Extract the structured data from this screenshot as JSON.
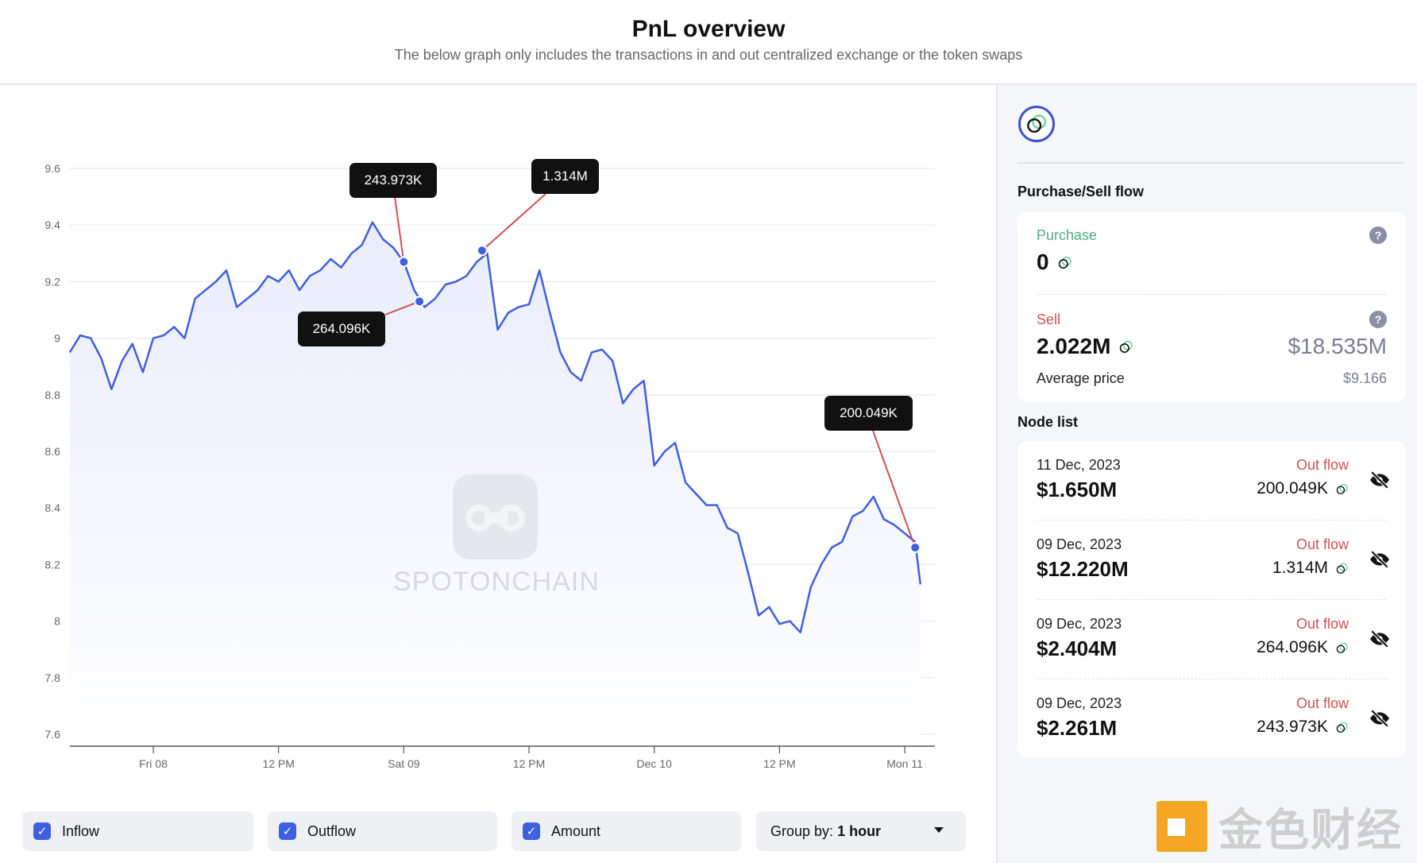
{
  "header": {
    "title": "PnL overview",
    "subtitle": "The below graph only includes the transactions in and out centralized exchange or the token swaps"
  },
  "watermark": {
    "text": "SPOTONCHAIN"
  },
  "chart_data": {
    "type": "area",
    "line_color": "#3d5fe0",
    "fill_color": "#e9ecfc",
    "grid": true,
    "ylim": [
      7.6,
      9.6
    ],
    "y_ticks": [
      "9.6",
      "9.4",
      "9.2",
      "9",
      "8.8",
      "8.6",
      "8.4",
      "8.2",
      "8",
      "7.8",
      "7.6"
    ],
    "x_ticks": [
      {
        "label": "Fri 08",
        "t": "2023-12-08T00:00"
      },
      {
        "label": "12 PM",
        "t": "2023-12-08T12:00"
      },
      {
        "label": "Sat 09",
        "t": "2023-12-09T00:00"
      },
      {
        "label": "12 PM",
        "t": "2023-12-09T12:00"
      },
      {
        "label": "Dec 10",
        "t": "2023-12-10T00:00"
      },
      {
        "label": "12 PM",
        "t": "2023-12-10T12:00"
      },
      {
        "label": "Mon 11",
        "t": "2023-12-11T00:00"
      }
    ],
    "x_range": [
      "2023-12-07T16:00",
      "2023-12-11T02:30"
    ],
    "x": [
      "2023-12-07T16:00",
      "2023-12-07T17:00",
      "2023-12-07T18:00",
      "2023-12-07T19:00",
      "2023-12-07T20:00",
      "2023-12-07T21:00",
      "2023-12-07T22:00",
      "2023-12-07T23:00",
      "2023-12-08T00:00",
      "2023-12-08T01:00",
      "2023-12-08T02:00",
      "2023-12-08T03:00",
      "2023-12-08T04:00",
      "2023-12-08T05:00",
      "2023-12-08T06:00",
      "2023-12-08T07:00",
      "2023-12-08T08:00",
      "2023-12-08T09:00",
      "2023-12-08T10:00",
      "2023-12-08T11:00",
      "2023-12-08T12:00",
      "2023-12-08T13:00",
      "2023-12-08T14:00",
      "2023-12-08T15:00",
      "2023-12-08T16:00",
      "2023-12-08T17:00",
      "2023-12-08T18:00",
      "2023-12-08T19:00",
      "2023-12-08T20:00",
      "2023-12-08T21:00",
      "2023-12-08T22:00",
      "2023-12-08T23:00",
      "2023-12-09T00:00",
      "2023-12-09T01:00",
      "2023-12-09T02:00",
      "2023-12-09T03:00",
      "2023-12-09T04:00",
      "2023-12-09T05:00",
      "2023-12-09T06:00",
      "2023-12-09T07:00",
      "2023-12-09T08:00",
      "2023-12-09T09:00",
      "2023-12-09T10:00",
      "2023-12-09T11:00",
      "2023-12-09T12:00",
      "2023-12-09T13:00",
      "2023-12-09T14:00",
      "2023-12-09T15:00",
      "2023-12-09T16:00",
      "2023-12-09T17:00",
      "2023-12-09T18:00",
      "2023-12-09T19:00",
      "2023-12-09T20:00",
      "2023-12-09T21:00",
      "2023-12-09T22:00",
      "2023-12-09T23:00",
      "2023-12-10T00:00",
      "2023-12-10T01:00",
      "2023-12-10T02:00",
      "2023-12-10T03:00",
      "2023-12-10T04:00",
      "2023-12-10T05:00",
      "2023-12-10T06:00",
      "2023-12-10T07:00",
      "2023-12-10T08:00",
      "2023-12-10T09:00",
      "2023-12-10T10:00",
      "2023-12-10T11:00",
      "2023-12-10T12:00",
      "2023-12-10T13:00",
      "2023-12-10T14:00",
      "2023-12-10T15:00",
      "2023-12-10T16:00",
      "2023-12-10T17:00",
      "2023-12-10T18:00",
      "2023-12-10T19:00",
      "2023-12-10T20:00",
      "2023-12-10T21:00",
      "2023-12-10T22:00",
      "2023-12-10T23:00",
      "2023-12-11T00:00",
      "2023-12-11T01:00",
      "2023-12-11T01:30"
    ],
    "y": [
      8.95,
      9.01,
      9.0,
      8.93,
      8.82,
      8.92,
      8.98,
      8.88,
      9.0,
      9.01,
      9.04,
      9.0,
      9.14,
      9.17,
      9.2,
      9.24,
      9.11,
      9.14,
      9.17,
      9.22,
      9.2,
      9.24,
      9.17,
      9.22,
      9.24,
      9.28,
      9.25,
      9.3,
      9.33,
      9.41,
      9.35,
      9.32,
      9.27,
      9.17,
      9.11,
      9.14,
      9.19,
      9.2,
      9.22,
      9.27,
      9.3,
      9.03,
      9.09,
      9.11,
      9.12,
      9.24,
      9.09,
      8.95,
      8.88,
      8.85,
      8.95,
      8.96,
      8.92,
      8.77,
      8.82,
      8.85,
      8.55,
      8.6,
      8.63,
      8.49,
      8.45,
      8.41,
      8.41,
      8.33,
      8.31,
      8.17,
      8.02,
      8.05,
      7.99,
      8.0,
      7.96,
      8.12,
      8.2,
      8.26,
      8.28,
      8.37,
      8.39,
      8.44,
      8.36,
      8.34,
      8.31,
      8.28,
      8.13
    ],
    "annotations": [
      {
        "label": "243.973K",
        "t": "2023-12-09T00:00",
        "y": 9.27,
        "line_color": "#d2504f"
      },
      {
        "label": "1.314M",
        "t": "2023-12-09T07:30",
        "y": 9.31,
        "line_color": "#d2504f"
      },
      {
        "label": "264.096K",
        "t": "2023-12-09T01:30",
        "y": 9.13,
        "line_color": "#d2504f"
      },
      {
        "label": "200.049K",
        "t": "2023-12-11T01:00",
        "y": 8.26,
        "line_color": "#d2504f"
      }
    ]
  },
  "controls": {
    "inflow": {
      "label": "Inflow",
      "checked": true
    },
    "outflow": {
      "label": "Outflow",
      "checked": true
    },
    "amount": {
      "label": "Amount",
      "checked": true
    },
    "group_by": {
      "label": "Group by:",
      "value": "1 hour"
    }
  },
  "side": {
    "flow_title": "Purchase/Sell flow",
    "purchase": {
      "label": "Purchase",
      "amount": "0",
      "color": "#4caf7d"
    },
    "sell": {
      "label": "Sell",
      "amount": "2.022M",
      "usd": "$18.535M",
      "avg_label": "Average price",
      "avg": "$9.166",
      "color": "#d2504f"
    },
    "help_icon": "?",
    "node_title": "Node list",
    "nodes": [
      {
        "date": "11 Dec, 2023",
        "usd": "$1.650M",
        "flow": "Out flow",
        "amount": "200.049K"
      },
      {
        "date": "09 Dec, 2023",
        "usd": "$12.220M",
        "flow": "Out flow",
        "amount": "1.314M"
      },
      {
        "date": "09 Dec, 2023",
        "usd": "$2.404M",
        "flow": "Out flow",
        "amount": "264.096K"
      },
      {
        "date": "09 Dec, 2023",
        "usd": "$2.261M",
        "flow": "Out flow",
        "amount": "243.973K"
      }
    ]
  },
  "brand_logo": {
    "text": "金色财经"
  }
}
